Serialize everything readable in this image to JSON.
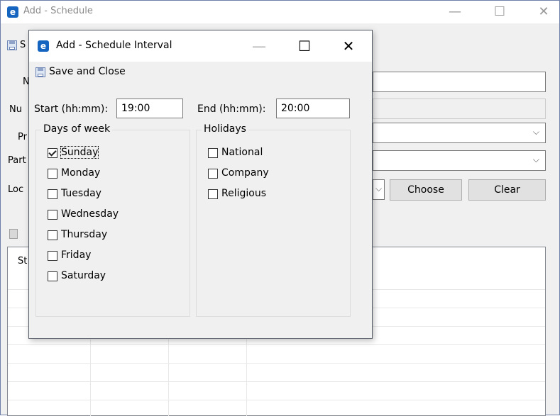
{
  "bg_window": {
    "title": "Add - Schedule",
    "icon": "app-logo-icon",
    "toolbar_label_fragment": "S",
    "field_labels": [
      "N",
      "Nu",
      "Pr",
      "Part",
      "Loc"
    ],
    "choose_label": "Choose",
    "clear_label": "Clear",
    "grid_header_fragment": "St",
    "accent_color": "#1565c0"
  },
  "dialog": {
    "title": "Add - Schedule Interval",
    "minimize_glyph": "—",
    "maximize_glyph": "☐",
    "close_glyph": "✕",
    "save_close_label": "Save and Close",
    "start_label": "Start (hh:mm):",
    "start_value": "19:00",
    "end_label": "End (hh:mm):",
    "end_value": "20:00",
    "days_group_label": "Days of week",
    "days": [
      {
        "label": "Sunday",
        "checked": true
      },
      {
        "label": "Monday",
        "checked": false
      },
      {
        "label": "Tuesday",
        "checked": false
      },
      {
        "label": "Wednesday",
        "checked": false
      },
      {
        "label": "Thursday",
        "checked": false
      },
      {
        "label": "Friday",
        "checked": false
      },
      {
        "label": "Saturday",
        "checked": false
      }
    ],
    "holidays_group_label": "Holidays",
    "holidays": [
      {
        "label": "National",
        "checked": false
      },
      {
        "label": "Company",
        "checked": false
      },
      {
        "label": "Religious",
        "checked": false
      }
    ]
  }
}
